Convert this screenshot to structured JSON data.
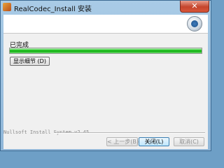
{
  "window": {
    "title": "RealCodec_Install 安装",
    "close_glyph": "✕"
  },
  "status": {
    "label": "已完成",
    "progress_fraction": 1.0
  },
  "details_button": {
    "label": "显示细节 (D)"
  },
  "branding": {
    "text": "Nullsoft Install System v2.45"
  },
  "buttons": {
    "back": "< 上一步(B)",
    "close": "关闭(L)",
    "cancel": "取消(C)"
  },
  "colors": {
    "progress": "#12c012",
    "titlebar": "#9cc2e2"
  },
  "icons": {
    "app": "installer-app-icon",
    "header": "disc-icon"
  }
}
